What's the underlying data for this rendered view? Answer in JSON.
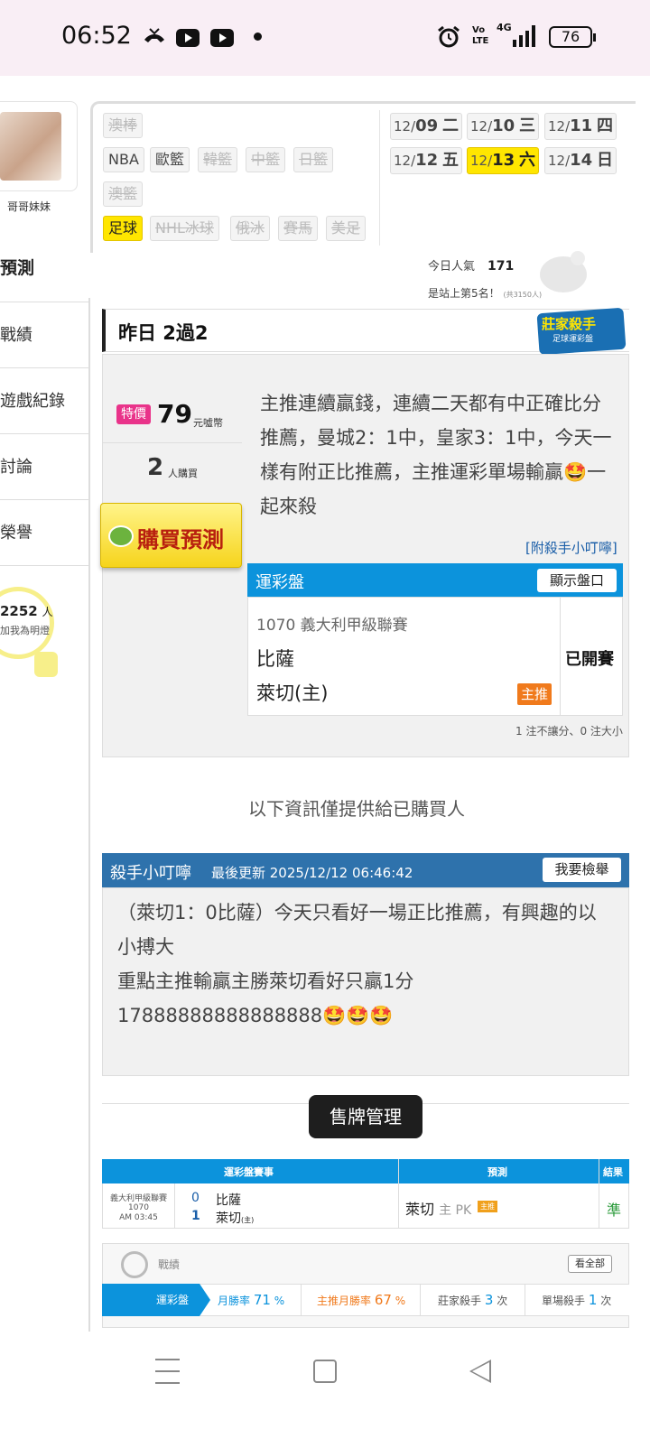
{
  "status_bar": {
    "time": "06:52",
    "battery": "76",
    "network": "4G"
  },
  "sidebar": {
    "name": "哥哥妹妹",
    "title": "預測",
    "menu": [
      "戰績",
      "遊戲紀錄",
      "討論",
      "榮譽"
    ],
    "fans_count": "2252",
    "fans_unit": "人",
    "fans_label": "加我為明燈"
  },
  "sports": [
    {
      "label": "澳棒",
      "state": "disabled"
    },
    {
      "label": "NBA",
      "state": "normal"
    },
    {
      "label": "歐籃",
      "state": "normal"
    },
    {
      "label": "韓籃",
      "state": "disabled"
    },
    {
      "label": "中籃",
      "state": "disabled"
    },
    {
      "label": "日籃",
      "state": "disabled"
    },
    {
      "label": "澳籃",
      "state": "disabled"
    },
    {
      "label": "足球",
      "state": "active"
    },
    {
      "label": "NHL冰球",
      "state": "disabled"
    },
    {
      "label": "俄冰",
      "state": "disabled"
    },
    {
      "label": "賽馬",
      "state": "disabled"
    },
    {
      "label": "美足",
      "state": "disabled"
    }
  ],
  "dates": [
    {
      "month": "12/",
      "day": "09",
      "weekday": "二",
      "active": false
    },
    {
      "month": "12/",
      "day": "10",
      "weekday": "三",
      "active": false
    },
    {
      "month": "12/",
      "day": "11",
      "weekday": "四",
      "active": false
    },
    {
      "month": "12/",
      "day": "12",
      "weekday": "五",
      "active": false
    },
    {
      "month": "12/",
      "day": "13",
      "weekday": "六",
      "active": true
    },
    {
      "month": "12/",
      "day": "14",
      "weekday": "日",
      "active": false
    }
  ],
  "popularity": {
    "label": "今日人氣",
    "value": "171",
    "rank_text": "是站上第5名！",
    "rank_total": "(共3150人)"
  },
  "yesterday": {
    "title": "昨日 2過2",
    "badge_title": "莊家殺手",
    "badge_sub": "足球運彩盤"
  },
  "offer": {
    "special_label": "特價",
    "price": "79",
    "price_unit": "元噓幣",
    "buyers": "2",
    "buyers_unit": "人購買",
    "buy_button": "購買預測",
    "description": "主推連續贏錢，連續二天都有中正確比分推薦，曼城2：1中，皇家3：1中，今天一樣有附正比推薦，主推運彩單場輸贏🤩一起來殺",
    "killer_link": "[附殺手小叮嚀]"
  },
  "lottery": {
    "title": "運彩盤",
    "show_button": "顯示盤口",
    "league": "1070 義大利甲級聯賽",
    "team_away": "比薩",
    "team_home": "萊切(主)",
    "rec_tag": "主推",
    "status": "已開賽",
    "note": "1 注不讓分、0 注大小"
  },
  "buyers_note": "以下資訊僅提供給已購買人",
  "killer_note": {
    "title": "殺手小叮嚀",
    "updated": "最後更新 2025/12/12 06:46:42",
    "report_button": "我要檢舉",
    "body": "（萊切1：0比薩）今天只看好一場正比推薦，有興趣的以小搏大\n重點主推輸贏主勝萊切看好只贏1分\n17888888888888888🤩🤩🤩"
  },
  "toast": "售牌管理",
  "result_table": {
    "headers": [
      "運彩盤賽事",
      "預測",
      "結果"
    ],
    "league": "義大利甲級聯賽",
    "code": "1070",
    "time": "AM 03:45",
    "score_away": "0",
    "score_home": "1",
    "team_away": "比薩",
    "team_home": "萊切",
    "home_mark": "(主)",
    "prediction_team": "萊切",
    "prediction_detail": "主 PK",
    "prediction_tag": "主推",
    "result": "準"
  },
  "record": {
    "title": "戰績",
    "view_all": "看全部",
    "category": "運彩盤",
    "month_win_label": "月勝率",
    "month_win": "71",
    "main_win_label": "主推月勝率",
    "main_win": "67",
    "banker_label": "莊家殺手",
    "banker": "3",
    "single_label": "單場殺手",
    "single": "1",
    "percent": "%",
    "times": "次"
  },
  "colors": {
    "blue": "#0c93dc",
    "dark_blue": "#2e72ac",
    "yellow": "#ffe600",
    "orange": "#f07a1c",
    "pink": "#e9338a"
  }
}
